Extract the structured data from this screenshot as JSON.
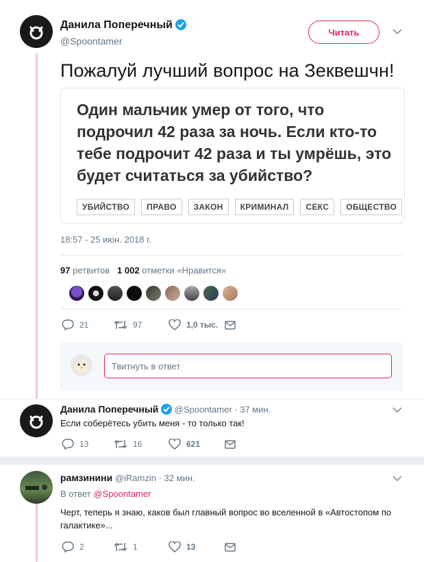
{
  "main_tweet": {
    "author_name": "Данила Поперечный",
    "author_handle": "@Spoontamer",
    "follow_label": "Читать",
    "text": "Пожалуй лучший вопрос на Зеквешчн!",
    "card": {
      "question": "Один мальчик умер от того, что подрочил 42 раза за ночь. Если кто-то тебе подрочит 42 раза и ты умрёшь, это будет считаться за убийство?",
      "tags": [
        "УБИЙСТВО",
        "ПРАВО",
        "ЗАКОН",
        "КРИМИНАЛ",
        "СЕКС",
        "ОБЩЕСТВО"
      ]
    },
    "timestamp": "18:57 - 25 июн. 2018 г.",
    "retweets_count": "97",
    "retweets_label": "ретвитов",
    "likes_count": "1 002",
    "likes_label": "отметки «Нравится»",
    "actions": {
      "replies": "21",
      "retweets": "97",
      "likes": "1,0 тыс."
    }
  },
  "reply_composer": {
    "placeholder": "Твитнуть в ответ"
  },
  "replies": [
    {
      "author_name": "Данила Поперечный",
      "author_handle": "@Spoontamer",
      "time": "· 37 мин.",
      "text": "Если соберётесь убить меня - то только так!",
      "actions": {
        "replies": "13",
        "retweets": "16",
        "likes": "621"
      }
    },
    {
      "author_name": "рамзинини",
      "author_handle": "@iRamzin",
      "time": "· 32 мин.",
      "in_reply_prefix": "В ответ",
      "in_reply_to": "@Spoontamer",
      "text": "Черт, теперь я знаю, каков был главный вопрос во вселенной в «Автостопом по галактике»...",
      "actions": {
        "replies": "2",
        "retweets": "1",
        "likes": "13"
      }
    }
  ],
  "colors": {
    "accent": "#e0245e",
    "verified": "#1da1f2",
    "muted": "#657786",
    "thread_line": "#f2c7cd"
  }
}
